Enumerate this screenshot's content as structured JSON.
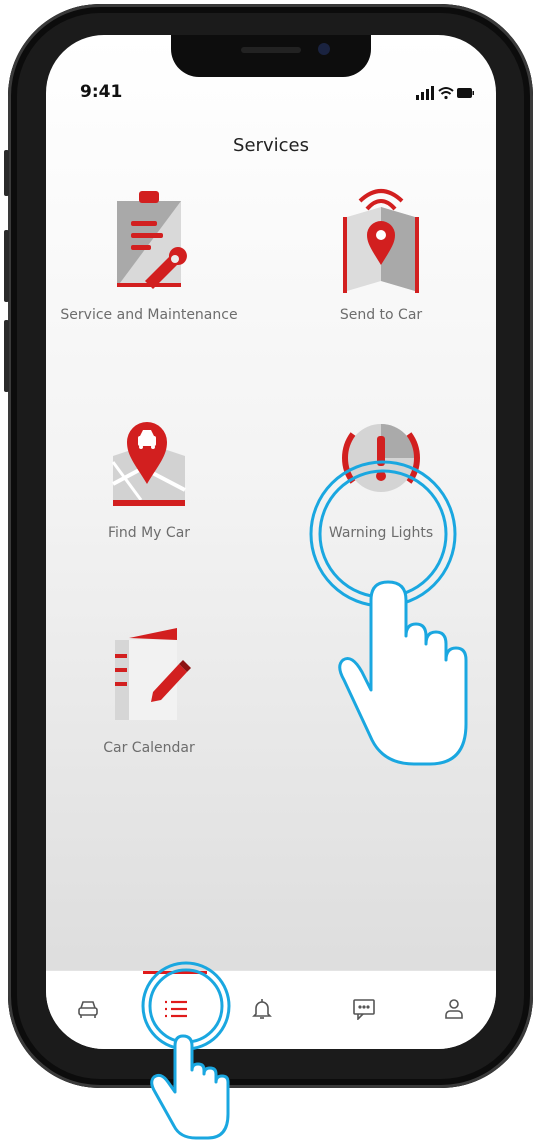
{
  "status": {
    "time": "9:41"
  },
  "header": {
    "title": "Services"
  },
  "services": [
    {
      "label": "Service and Maintenance",
      "icon": "clipboard-wrench-icon"
    },
    {
      "label": "Send to Car",
      "icon": "map-signal-icon"
    },
    {
      "label": "Find My Car",
      "icon": "map-pin-car-icon"
    },
    {
      "label": "Warning Lights",
      "icon": "warning-light-icon"
    },
    {
      "label": "Car Calendar",
      "icon": "calendar-pencil-icon"
    }
  ],
  "tabbar": {
    "items": [
      {
        "name": "car",
        "icon": "car-icon"
      },
      {
        "name": "services",
        "icon": "list-icon",
        "active": true
      },
      {
        "name": "notifications",
        "icon": "bell-icon"
      },
      {
        "name": "messages",
        "icon": "chat-icon"
      },
      {
        "name": "profile",
        "icon": "person-icon"
      }
    ]
  },
  "colors": {
    "accent": "#e01a1a",
    "highlight": "#1aa7e0",
    "label": "#6d6d6d"
  }
}
